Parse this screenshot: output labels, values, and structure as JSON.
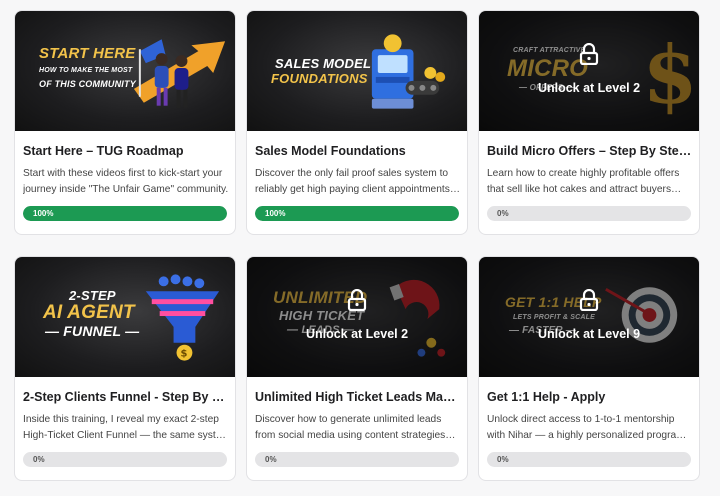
{
  "colors": {
    "accent_green": "#1c9a53",
    "locked_gray": "#e4e4e6"
  },
  "courses": [
    {
      "title": "Start Here – TUG Roadmap",
      "desc_lines": [
        "Start with these videos first to kick-start your",
        "journey inside \"The Unfair Game\" community."
      ],
      "progress_label": "100%",
      "progress": 1.0,
      "thumb": {
        "title_lines": [
          "START HERE"
        ],
        "sub_lines": [
          "HOW TO MAKE THE MOST",
          "OF THIS COMMUNITY"
        ]
      },
      "locked": false
    },
    {
      "title": "Sales Model Foundations",
      "desc_lines": [
        "Discover the only fail proof sales system to",
        "reliably get high paying client appointments…"
      ],
      "progress_label": "100%",
      "progress": 1.0,
      "thumb": {
        "title_lines": [
          "SALES MODEL",
          "FOUNDATIONS"
        ],
        "sub_lines": []
      },
      "locked": false
    },
    {
      "title": "Build Micro Offers – Step By Step …",
      "desc_lines": [
        "Learn how to create highly profitable offers",
        "that sell like hot cakes and attract buyers…"
      ],
      "progress_label": "0%",
      "progress": 0,
      "thumb": {
        "title_lines": [
          "MICRO"
        ],
        "sub_lines": [
          "CRAFT ATTRACTIVE",
          "— OFFERS —"
        ]
      },
      "locked": true,
      "lock_label": "Unlock at Level 2"
    },
    {
      "title": "2-Step Clients Funnel - Step By St…",
      "desc_lines": [
        "Inside this training, I reveal my exact 2-step",
        "High-Ticket Client Funnel — the same syste…"
      ],
      "progress_label": "0%",
      "progress": 0,
      "thumb": {
        "title_lines": [
          "2-STEP",
          "AI AGENT",
          "— FUNNEL —"
        ],
        "sub_lines": []
      },
      "locked": false
    },
    {
      "title": "Unlimited High Ticket Leads Mac…",
      "desc_lines": [
        "Discover how to generate unlimited leads",
        "from social media using content strategies…"
      ],
      "progress_label": "0%",
      "progress": 0,
      "thumb": {
        "title_lines": [
          "UNLIMITED",
          "HIGH TICKET",
          "— LEADS —"
        ],
        "sub_lines": []
      },
      "locked": true,
      "lock_label": "Unlock at Level 2"
    },
    {
      "title": "Get 1:1 Help - Apply",
      "desc_lines": [
        "Unlock direct access to 1-to-1 mentorship",
        "with Nihar — a highly personalized program…"
      ],
      "progress_label": "0%",
      "progress": 0,
      "thumb": {
        "title_lines": [
          "GET 1:1 HELP"
        ],
        "sub_lines": [
          "LETS PROFIT & SCALE",
          "— FASTER —"
        ]
      },
      "locked": true,
      "lock_label": "Unlock at Level 9"
    }
  ]
}
